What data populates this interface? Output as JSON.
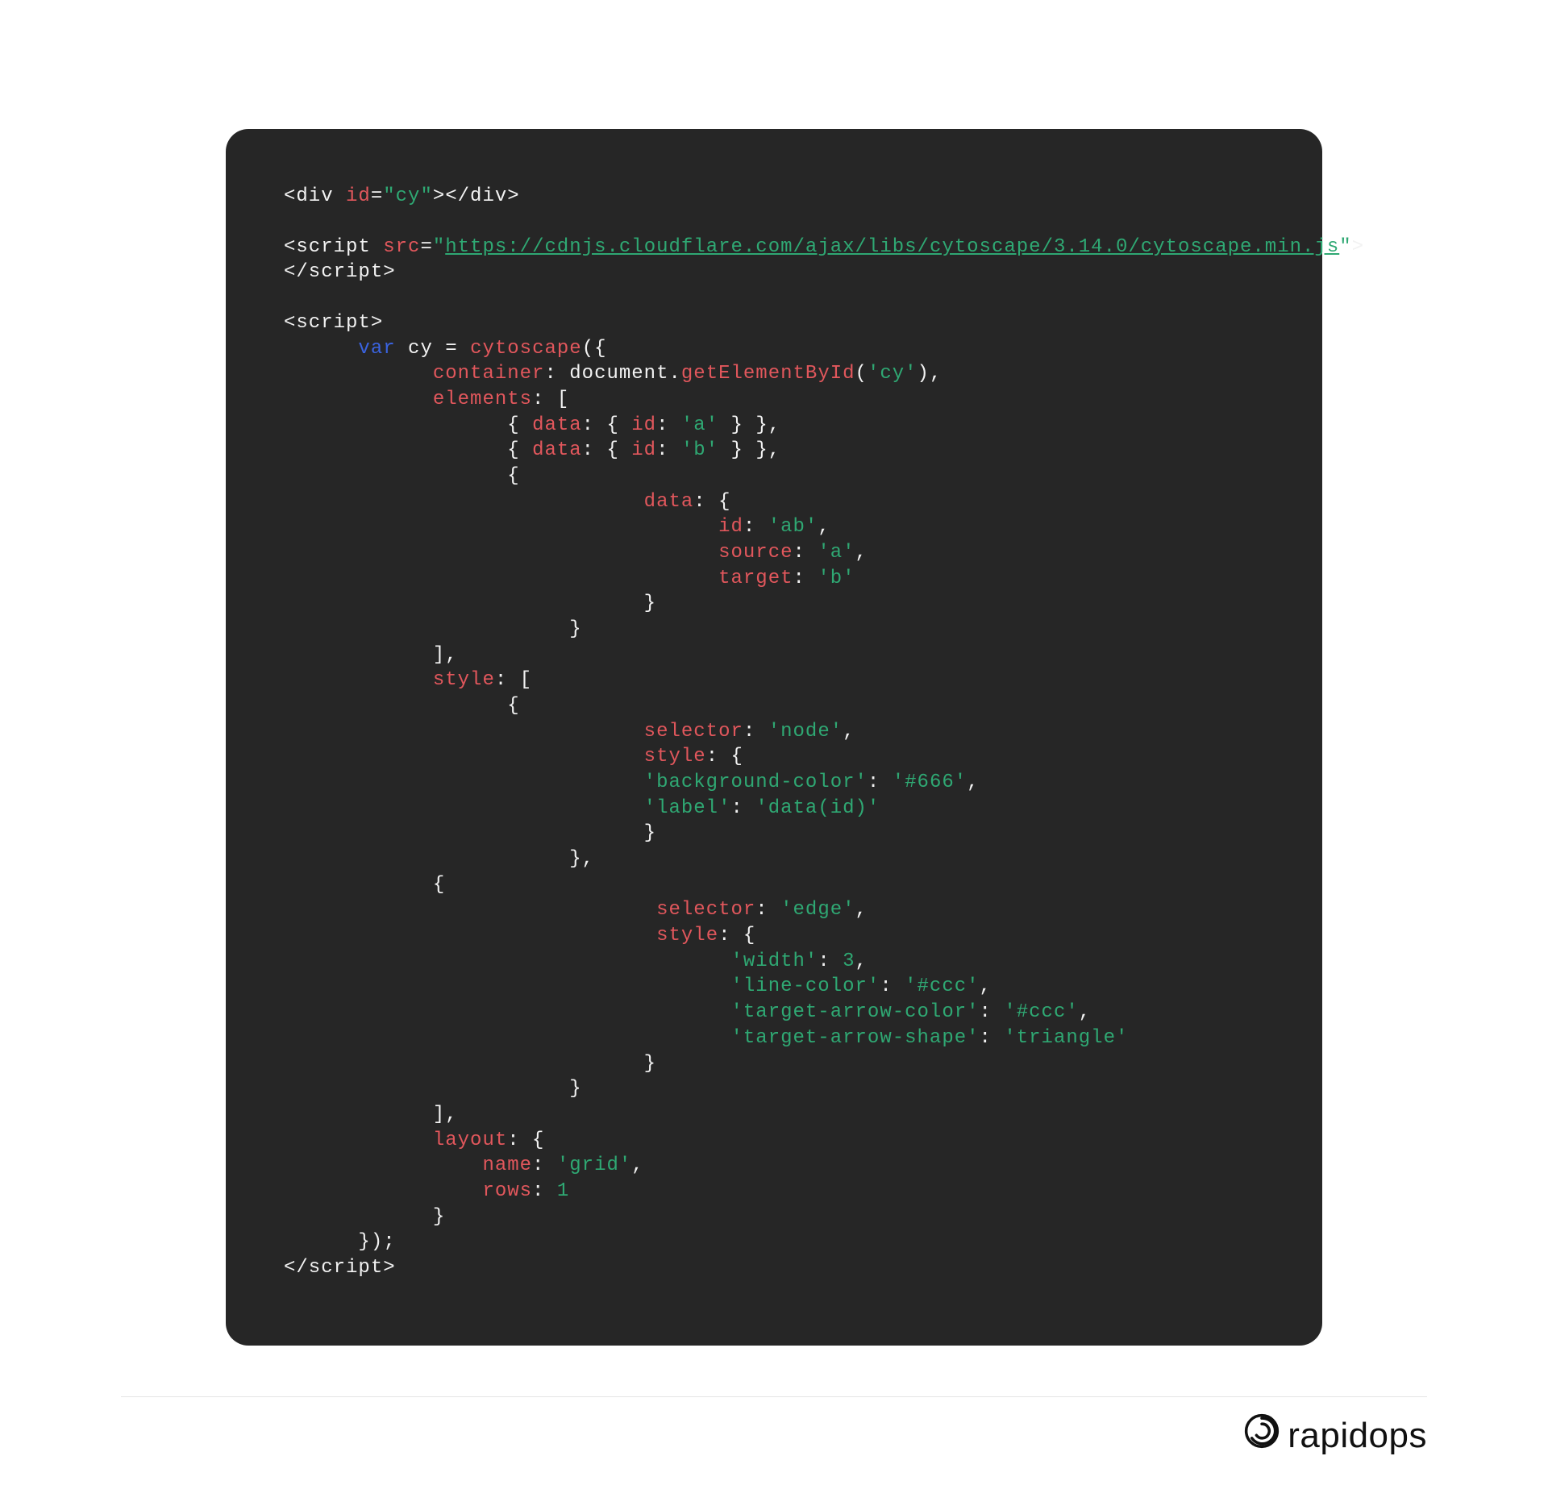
{
  "code": {
    "t01a": "<div ",
    "t01b": "id",
    "t01c": "=",
    "t01d": "\"cy\"",
    "t01e": "></div>",
    "t02a": "<script ",
    "t02b": "src",
    "t02c": "=",
    "t02d": "\"",
    "t02e": "https://cdnjs.cloudflare.com/ajax/libs/cytoscape/3.14.0/cytoscape.min.js",
    "t02f": "\"",
    "t02g": ">",
    "t03a": "</script>",
    "t04a": "<script>",
    "t05a": "var",
    "t05b": " cy = ",
    "t05c": "cytoscape",
    "t05d": "({",
    "t06a": "container",
    "t06b": ": document.",
    "t06c": "getElementById",
    "t06d": "(",
    "t06e": "'cy'",
    "t06f": "),",
    "t07a": "elements",
    "t07b": ": [",
    "t08a": "{ ",
    "t08b": "data",
    "t08c": ": { ",
    "t08d": "id",
    "t08e": ": ",
    "t08f": "'a'",
    "t08g": " } },",
    "t09a": "{ ",
    "t09b": "data",
    "t09c": ": { ",
    "t09d": "id",
    "t09e": ": ",
    "t09f": "'b'",
    "t09g": " } },",
    "t10a": "{",
    "t11a": "data",
    "t11b": ": {",
    "t12a": "id",
    "t12b": ": ",
    "t12c": "'ab'",
    "t12d": ",",
    "t13a": "source",
    "t13b": ": ",
    "t13c": "'a'",
    "t13d": ",",
    "t14a": "target",
    "t14b": ": ",
    "t14c": "'b'",
    "t15a": "}",
    "t16a": "}",
    "t17a": "],",
    "t18a": "style",
    "t18b": ": [",
    "t19a": "{",
    "t20a": "selector",
    "t20b": ": ",
    "t20c": "'node'",
    "t20d": ",",
    "t21a": "style",
    "t21b": ": {",
    "t22a": "'background-color'",
    "t22b": ": ",
    "t22c": "'#666'",
    "t22d": ",",
    "t23a": "'label'",
    "t23b": ": ",
    "t23c": "'data(id)'",
    "t24a": "}",
    "t25a": "},",
    "t26a": "{",
    "t27a": "selector",
    "t27b": ": ",
    "t27c": "'edge'",
    "t27d": ",",
    "t28a": "style",
    "t28b": ": {",
    "t29a": "'width'",
    "t29b": ": ",
    "t29c": "3",
    "t29d": ",",
    "t30a": "'line-color'",
    "t30b": ": ",
    "t30c": "'#ccc'",
    "t30d": ",",
    "t31a": "'target-arrow-color'",
    "t31b": ": ",
    "t31c": "'#ccc'",
    "t31d": ",",
    "t32a": "'target-arrow-shape'",
    "t32b": ": ",
    "t32c": "'triangle'",
    "t33a": "}",
    "t34a": "}",
    "t35a": "],",
    "t36a": "layout",
    "t36b": ": {",
    "t37a": "name",
    "t37b": ": ",
    "t37c": "'grid'",
    "t37d": ",",
    "t38a": "rows",
    "t38b": ": ",
    "t38c": "1",
    "t39a": "}",
    "t40a": "});",
    "t41a": "</script>"
  },
  "footer": {
    "brand": "rapidops"
  }
}
